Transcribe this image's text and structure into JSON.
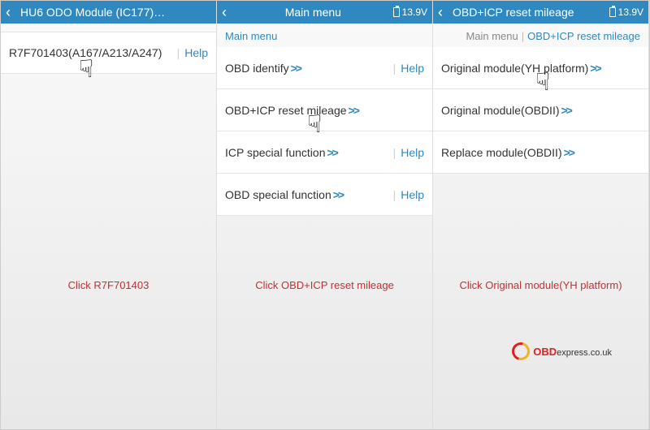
{
  "panelA": {
    "title": "HU6 ODO Module (IC177)…",
    "row1": "R7F701403(A167/A213/A247)",
    "help": "Help",
    "caption": "Click R7F701403"
  },
  "panelB": {
    "title": "Main menu",
    "voltage": "13.9V",
    "breadcrumb": "Main menu",
    "items": {
      "0": {
        "label": "OBD identify",
        "help": "Help"
      },
      "1": {
        "label": "OBD+ICP reset mileage",
        "help": ""
      },
      "2": {
        "label": "ICP special function",
        "help": "Help"
      },
      "3": {
        "label": "OBD special function",
        "help": "Help"
      }
    },
    "caption": "Click OBD+ICP reset mileage"
  },
  "panelC": {
    "title": "OBD+ICP reset mileage",
    "voltage": "13.9V",
    "breadcrumbRoot": "Main menu",
    "breadcrumbActive": "OBD+ICP reset mileage",
    "items": {
      "0": {
        "label": "Original module(YH platform)"
      },
      "1": {
        "label": "Original module(OBDII)"
      },
      "2": {
        "label": "Replace module(OBDII)"
      }
    },
    "caption": "Click Original module(YH platform)"
  },
  "arrows": ">>",
  "sep": "|",
  "logo": {
    "a": "OBD",
    "b": "express",
    ".c": ".co.uk"
  }
}
